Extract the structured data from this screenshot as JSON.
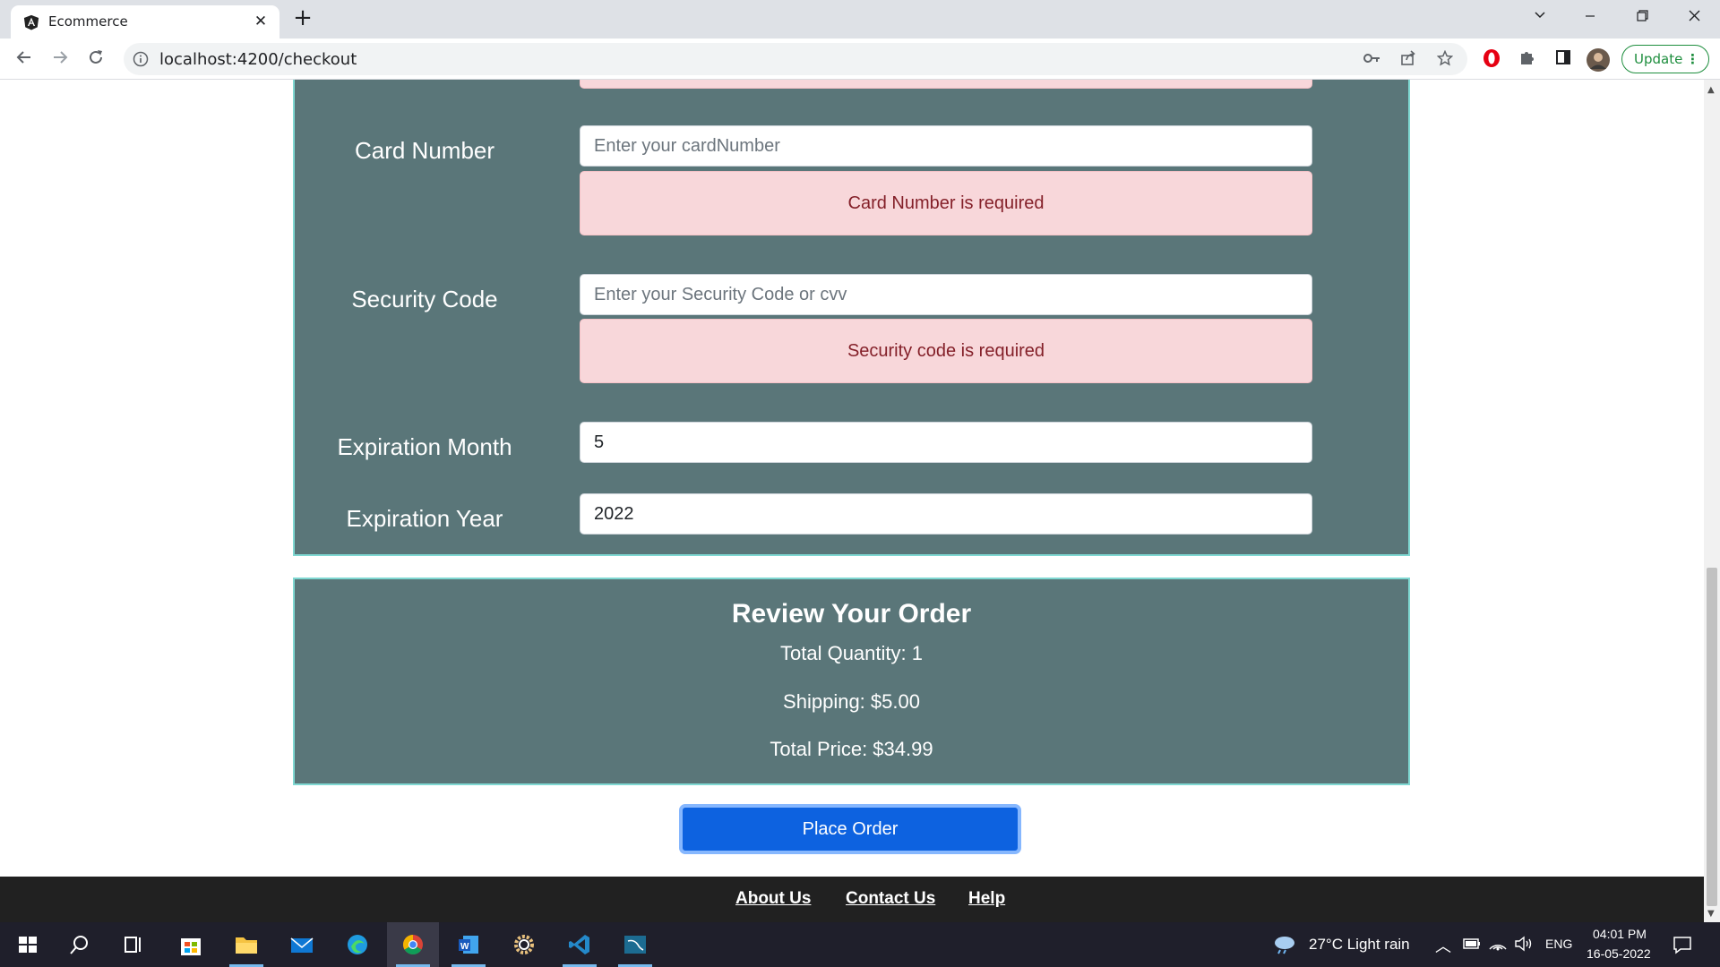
{
  "browser": {
    "tab_title": "Ecommerce",
    "tab_close": "✕",
    "new_tab": "+",
    "url": "localhost:4200/checkout",
    "update_label": "Update",
    "update_menu": "⋮"
  },
  "form": {
    "card_number": {
      "label": "Card Number",
      "placeholder": "Enter your cardNumber",
      "error": "Card Number is required"
    },
    "security_code": {
      "label": "Security Code",
      "placeholder": "Enter your Security Code or cvv",
      "error": "Security code is required"
    },
    "expiration_month": {
      "label": "Expiration Month",
      "value": "5"
    },
    "expiration_year": {
      "label": "Expiration Year",
      "value": "2022"
    }
  },
  "review": {
    "title": "Review Your Order",
    "total_quantity": "Total Quantity: 1",
    "shipping": "Shipping: $5.00",
    "total_price": "Total Price: $34.99"
  },
  "actions": {
    "place_order": "Place Order"
  },
  "footer": {
    "links": [
      "About Us",
      "Contact Us",
      "Help"
    ]
  },
  "taskbar": {
    "weather": "27°C  Light rain",
    "language": "ENG",
    "time": "04:01 PM",
    "date": "16-05-2022"
  },
  "colors": {
    "panel_bg": "#5a7679",
    "panel_border": "#7fd8d2",
    "alert_bg": "#f8d7da",
    "alert_text": "#842029",
    "primary_button": "#0d62e0",
    "footer_bg": "#212121"
  }
}
